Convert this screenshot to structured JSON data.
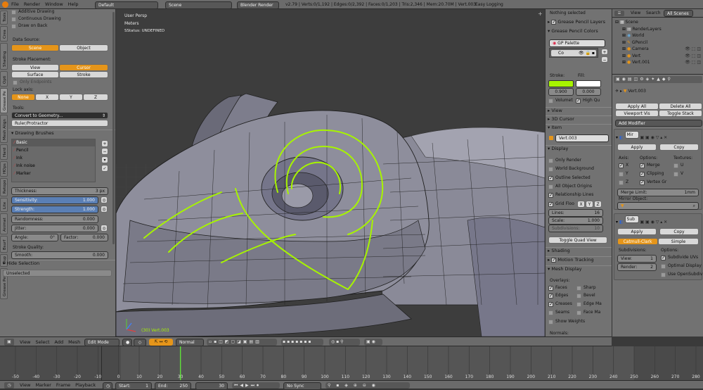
{
  "topbar": {
    "menus": [
      "File",
      "Render",
      "Window",
      "Help"
    ],
    "layout": "Default",
    "scene": "Scene",
    "engine": "Blender Render",
    "stats": "v2.79 | Verts:0/1,192 | Edges:0/2,392 | Faces:0/1,203 | Tris:2,346 | Mem:20.70M | Vert.003",
    "addon": "Easy Logging"
  },
  "tools": {
    "tabs": [
      "Tools",
      "Crea",
      "Shading",
      "Opti",
      "Grease Pe",
      "Mesh Align",
      "Hard",
      "HOps",
      "Retopo",
      "Lite",
      "Animat",
      "Bsurf",
      "Dup",
      "Grease Pencil"
    ],
    "additive": "Additive Drawing",
    "continuous": "Continuous Drawing",
    "drawback": "Draw on Back",
    "datasource": "Data Source:",
    "scene_btn": "Scene",
    "object_btn": "Object",
    "placement": "Stroke Placement:",
    "view_btn": "View",
    "cursor_btn": "Cursor",
    "surface_btn": "Surface",
    "stroke_btn": "Stroke",
    "endpoints": "Only Endpoints",
    "lockaxis": "Lock axis:",
    "none": "None",
    "x": "X",
    "y": "Y",
    "z": "Z",
    "toolslabel": "Tools:",
    "convert": "Convert to Geometry...",
    "ruler": "Ruler/Protractor",
    "brushes_header": "Drawing Brushes",
    "brushes": [
      "Basic",
      "Pencil",
      "Ink",
      "Ink noise",
      "Marker"
    ],
    "thickness_label": "Thickness:",
    "thickness": "3 px",
    "sensitivity_label": "Sensitivity:",
    "sensitivity": "1.000",
    "strength_label": "Strength:",
    "strength": "1.000",
    "randomness_label": "Randomness:",
    "randomness": "0.000",
    "jitter_label": "Jitter:",
    "jitter": "0.000",
    "angle_label": "Angle:",
    "angle": "0°",
    "factor_label": "Factor:",
    "factor": "0.000",
    "quality": "Stroke Quality:",
    "smooth_label": "Smooth:",
    "smooth": "0.000",
    "hide_header": "Hide Selection",
    "unselected": "Unselected"
  },
  "viewport": {
    "persp": "User Persp",
    "units": "Meters",
    "status": "SStatus: UNDEFINED",
    "object_label": "(30) Vert.003"
  },
  "vp_header": {
    "view": "View",
    "select": "Select",
    "add": "Add",
    "mesh": "Mesh",
    "mode": "Edit Mode",
    "pivot": "Normal"
  },
  "timeline": {
    "ticks": [
      "-50",
      "-40",
      "-30",
      "-20",
      "-10",
      "0",
      "10",
      "20",
      "30",
      "40",
      "50",
      "60",
      "70",
      "80",
      "90",
      "100",
      "110",
      "120",
      "130",
      "140",
      "150",
      "160",
      "170",
      "180",
      "190",
      "200",
      "210",
      "220",
      "230",
      "240",
      "250",
      "260",
      "270",
      "280"
    ],
    "current_frame": 30,
    "range": [
      -50,
      280
    ]
  },
  "tl_header": {
    "view": "View",
    "marker": "Marker",
    "frame": "Frame",
    "playback": "Playback",
    "start_label": "Start:",
    "start": "1",
    "end_label": "End:",
    "end": "250",
    "current": "30",
    "sync": "No Sync"
  },
  "npanel": {
    "nothing": "Nothing selected",
    "gp_layers": "Grease Pencil Layers",
    "gp_colors": "Grease Pencil Colors",
    "palette": "GP Palette",
    "color_name": "Co",
    "stroke_label": "Stroke:",
    "fill_label": "Fill:",
    "stroke_val": "0.900",
    "fill_val": "0.000",
    "volumet": "Volumet",
    "highq": "High Qu",
    "view": "View",
    "cursor3d": "3D Cursor",
    "item": "Item",
    "item_name": "Vert.003",
    "display": "Display",
    "only_render": "Only Render",
    "world_bg": "World Background",
    "outline": "Outline Selected",
    "all_origins": "All Object Origins",
    "rel_lines": "Relationship Lines",
    "grid_floor": "Grid Floo",
    "gx": "X",
    "gy": "Y",
    "gz": "Z",
    "lines_label": "Lines:",
    "lines": "16",
    "scale_label": "Scale:",
    "scale": "1.000",
    "subdiv_label": "Subdivisions:",
    "subdiv": "10",
    "toggle_quad": "Toggle Quad View",
    "shading": "Shading",
    "motion": "Motion Tracking",
    "mesh_display": "Mesh Display",
    "overlays": "Overlays:",
    "faces": "Faces",
    "sharp": "Sharp",
    "edges": "Edges",
    "bevel": "Bevel",
    "creases": "Creases",
    "edge_ma": "Edge Ma",
    "seams": "Seams",
    "face_ma": "Face Ma",
    "show_weights": "Show Weights",
    "normals": "Normals:"
  },
  "outliner": {
    "view": "View",
    "search": "Search",
    "all_scenes": "All Scenes",
    "items": [
      "Scene",
      "RenderLayers",
      "World",
      "GPencil",
      "Camera",
      "Vert",
      "Vert.001"
    ]
  },
  "properties": {
    "object": "Vert.003",
    "apply_all": "Apply All",
    "delete_all": "Delete All",
    "viewport_vis": "Viewport Vis",
    "toggle_stack": "Toggle Stack",
    "add_modifier": "Add Modifier",
    "mirror_name": "Mir",
    "apply": "Apply",
    "copy": "Copy",
    "axis": "Axis:",
    "options": "Options:",
    "textures": "Textures:",
    "ax_x": "X",
    "ax_y": "Y",
    "ax_z": "Z",
    "merge": "Merge",
    "clipping": "Clipping",
    "vertex_gr": "Vertex Gr",
    "tex_u": "U",
    "tex_v": "V",
    "merge_limit_label": "Merge Limit:",
    "merge_limit": "1mm",
    "mirror_object": "Mirror Object:",
    "subsurf_name": "Sub",
    "catmull": "Catmull-Clark",
    "simple": "Simple",
    "subdivisions": "Subdivisions:",
    "options2": "Options:",
    "view_label": "View:",
    "view_val": "1",
    "render_label": "Render:",
    "render_val": "2",
    "subdiv_uvs": "Subdivide UVs",
    "optimal": "Optimal Display",
    "opensubdiv": "Use OpenSubdiv"
  },
  "colors": {
    "accent": "#e5951a",
    "stroke": "#a7f400",
    "viewport": "#3d3d3d",
    "panel": "#727272"
  }
}
